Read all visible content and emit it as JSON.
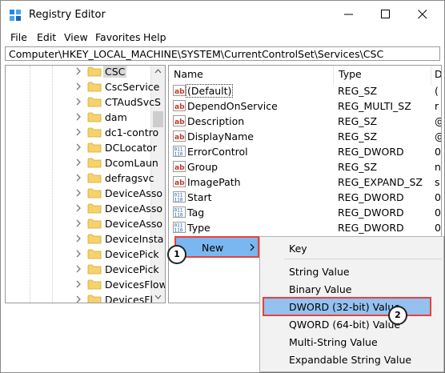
{
  "window": {
    "title": "Registry Editor"
  },
  "menu": [
    "File",
    "Edit",
    "View",
    "Favorites",
    "Help"
  ],
  "address": "Computer\\HKEY_LOCAL_MACHINE\\SYSTEM\\CurrentControlSet\\Services\\CSC",
  "tree": {
    "items": [
      {
        "label": "CSC",
        "selected": true
      },
      {
        "label": "CscService"
      },
      {
        "label": "CTAudSvcS"
      },
      {
        "label": "dam"
      },
      {
        "label": "dc1-contro"
      },
      {
        "label": "DCLocator"
      },
      {
        "label": "DcomLaun"
      },
      {
        "label": "defragsvc"
      },
      {
        "label": "DeviceAsso"
      },
      {
        "label": "DeviceAsso"
      },
      {
        "label": "DeviceAsso"
      },
      {
        "label": "DeviceInsta"
      },
      {
        "label": "DevicePick"
      },
      {
        "label": "DevicePick"
      },
      {
        "label": "DevicesFlow"
      },
      {
        "label": "DevicesFl"
      }
    ]
  },
  "values_header": {
    "name": "Name",
    "type": "Type",
    "data": "D"
  },
  "values": [
    {
      "name": "(Default)",
      "type": "REG_SZ",
      "data": "(",
      "icon": "string-value-icon",
      "selected": true
    },
    {
      "name": "DependOnService",
      "type": "REG_MULTI_SZ",
      "data": "r",
      "icon": "string-value-icon"
    },
    {
      "name": "Description",
      "type": "REG_SZ",
      "data": "@",
      "icon": "string-value-icon"
    },
    {
      "name": "DisplayName",
      "type": "REG_SZ",
      "data": "@",
      "icon": "string-value-icon"
    },
    {
      "name": "ErrorControl",
      "type": "REG_DWORD",
      "data": "0",
      "icon": "binary-value-icon"
    },
    {
      "name": "Group",
      "type": "REG_SZ",
      "data": "n",
      "icon": "string-value-icon"
    },
    {
      "name": "ImagePath",
      "type": "REG_EXPAND_SZ",
      "data": "s",
      "icon": "string-value-icon"
    },
    {
      "name": "Start",
      "type": "REG_DWORD",
      "data": "0",
      "icon": "binary-value-icon"
    },
    {
      "name": "Tag",
      "type": "REG_DWORD",
      "data": "0",
      "icon": "binary-value-icon"
    },
    {
      "name": "Type",
      "type": "REG_DWORD",
      "data": "0",
      "icon": "binary-value-icon"
    }
  ],
  "context_menu": {
    "new_label": "New",
    "badge": "1"
  },
  "submenu": {
    "items": [
      "Key",
      "String Value",
      "Binary Value",
      "DWORD (32-bit) Value",
      "QWORD (64-bit) Value",
      "Multi-String Value",
      "Expandable String Value"
    ],
    "highlighted": "DWORD (32-bit) Value",
    "badge": "2"
  },
  "colors": {
    "highlight_border": "#e8413b",
    "new_bg": "#7ab7f0",
    "dword_bg": "#94c1ef",
    "folder": "#f6d26a"
  }
}
